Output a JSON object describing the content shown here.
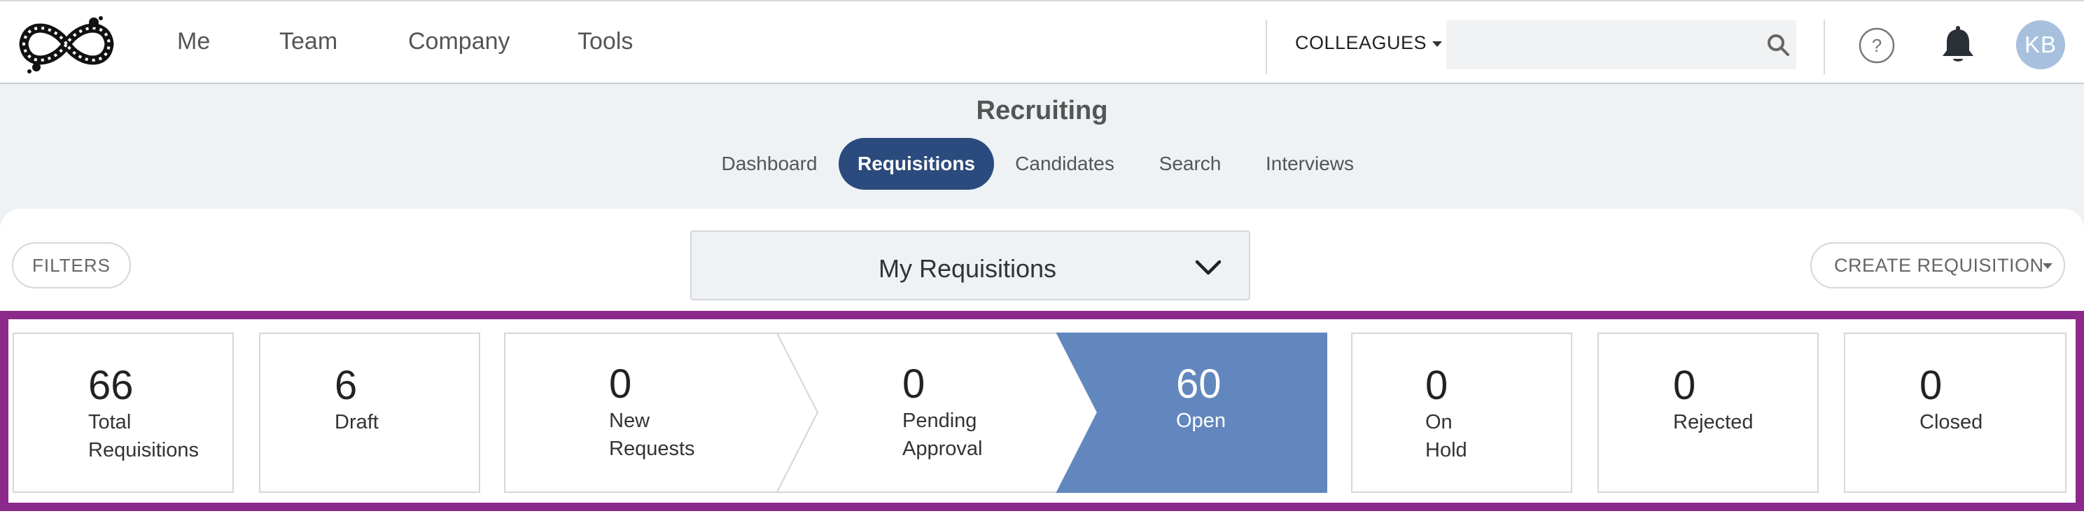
{
  "nav": {
    "items": [
      "Me",
      "Team",
      "Company",
      "Tools"
    ],
    "colleagues_label": "COLLEAGUES",
    "search_value": "",
    "avatar_initials": "KB"
  },
  "header": {
    "title": "Recruiting",
    "tabs": [
      {
        "label": "Dashboard",
        "active": false
      },
      {
        "label": "Requisitions",
        "active": true
      },
      {
        "label": "Candidates",
        "active": false
      },
      {
        "label": "Search",
        "active": false
      },
      {
        "label": "Interviews",
        "active": false
      }
    ]
  },
  "toolbar": {
    "filters_label": "FILTERS",
    "view_select": "My Requisitions",
    "create_label": "CREATE REQUISITION"
  },
  "status_cards": [
    {
      "count": "66",
      "label_1": "Total",
      "label_2": "Requisitions"
    },
    {
      "count": "6",
      "label_1": "Draft",
      "label_2": ""
    },
    {
      "count": "0",
      "label_1": "New",
      "label_2": "Requests"
    },
    {
      "count": "0",
      "label_1": "Pending",
      "label_2": "Approval"
    },
    {
      "count": "60",
      "label_1": "Open",
      "label_2": ""
    },
    {
      "count": "0",
      "label_1": "On",
      "label_2": "Hold"
    },
    {
      "count": "0",
      "label_1": "Rejected",
      "label_2": ""
    },
    {
      "count": "0",
      "label_1": "Closed",
      "label_2": ""
    }
  ],
  "colors": {
    "accent": "#2b4a7d",
    "open_fill": "#6287be",
    "highlight_border": "#8b2a8b",
    "avatar_bg": "#a7c0de"
  },
  "icons": {
    "logo": "infinity-logo",
    "search": "search-icon",
    "help": "help-icon",
    "notifications": "bell-icon",
    "dropdown": "chevron-down-icon"
  }
}
